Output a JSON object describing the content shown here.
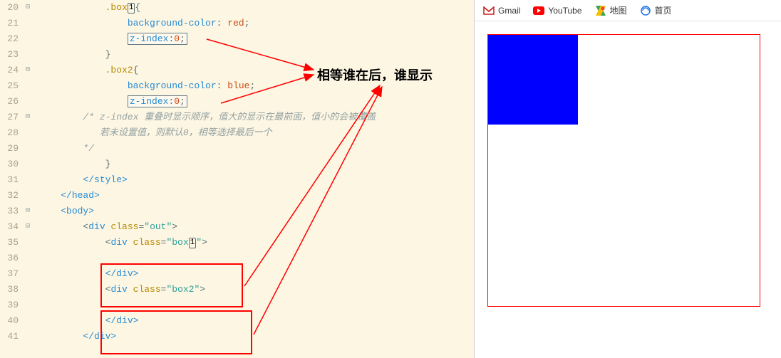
{
  "lines": [
    {
      "num": "20",
      "fold": "⊟"
    },
    {
      "num": "21",
      "fold": ""
    },
    {
      "num": "22",
      "fold": ""
    },
    {
      "num": "23",
      "fold": ""
    },
    {
      "num": "24",
      "fold": "⊟"
    },
    {
      "num": "25",
      "fold": ""
    },
    {
      "num": "26",
      "fold": ""
    },
    {
      "num": "27",
      "fold": "⊟"
    },
    {
      "num": "28",
      "fold": ""
    },
    {
      "num": "29",
      "fold": ""
    },
    {
      "num": "30",
      "fold": ""
    },
    {
      "num": "31",
      "fold": ""
    },
    {
      "num": "32",
      "fold": ""
    },
    {
      "num": "33",
      "fold": "⊟"
    },
    {
      "num": "34",
      "fold": "⊟"
    },
    {
      "num": "35",
      "fold": ""
    },
    {
      "num": "36",
      "fold": ""
    },
    {
      "num": "37",
      "fold": ""
    },
    {
      "num": "38",
      "fold": ""
    },
    {
      "num": "39",
      "fold": ""
    },
    {
      "num": "40",
      "fold": ""
    },
    {
      "num": "41",
      "fold": ""
    }
  ],
  "code": {
    "l20_sel": ".box",
    "l20_cursor": "1",
    "l20_brace": "{",
    "l21_prop": "background-color",
    "l21_val": "red",
    "l22_prop": "z-index",
    "l22_val": "0",
    "l23": "}",
    "l24_sel": ".box2",
    "l24_brace": "{",
    "l25_prop": "background-color",
    "l25_val": "blue",
    "l26_prop": "z-index",
    "l26_val": "0",
    "l27_comment": "/* z-index 重叠时显示顺序，值大的显示在最前面，值小的会被覆盖",
    "l28_comment": "   若未设置值，则默认0，相等选择最后一个",
    "l29_comment": "*/",
    "l30": "}",
    "l31": "</style>",
    "l32": "</head>",
    "l33": "<body>",
    "l34_tag": "div",
    "l34_attr": "class",
    "l34_val": "\"out\"",
    "l35_tag": "div",
    "l35_attr": "class",
    "l35_val_a": "\"box",
    "l35_cursor": "1",
    "l35_val_b": "\"",
    "l37": "</div>",
    "l38_tag": "div",
    "l38_attr": "class",
    "l38_val": "\"box2\"",
    "l40": "</div>",
    "l41": "</div>"
  },
  "annotation": "相等谁在后，谁显示",
  "bookmarks": {
    "gmail": "Gmail",
    "youtube": "YouTube",
    "maps": "地图",
    "home": "首页"
  }
}
